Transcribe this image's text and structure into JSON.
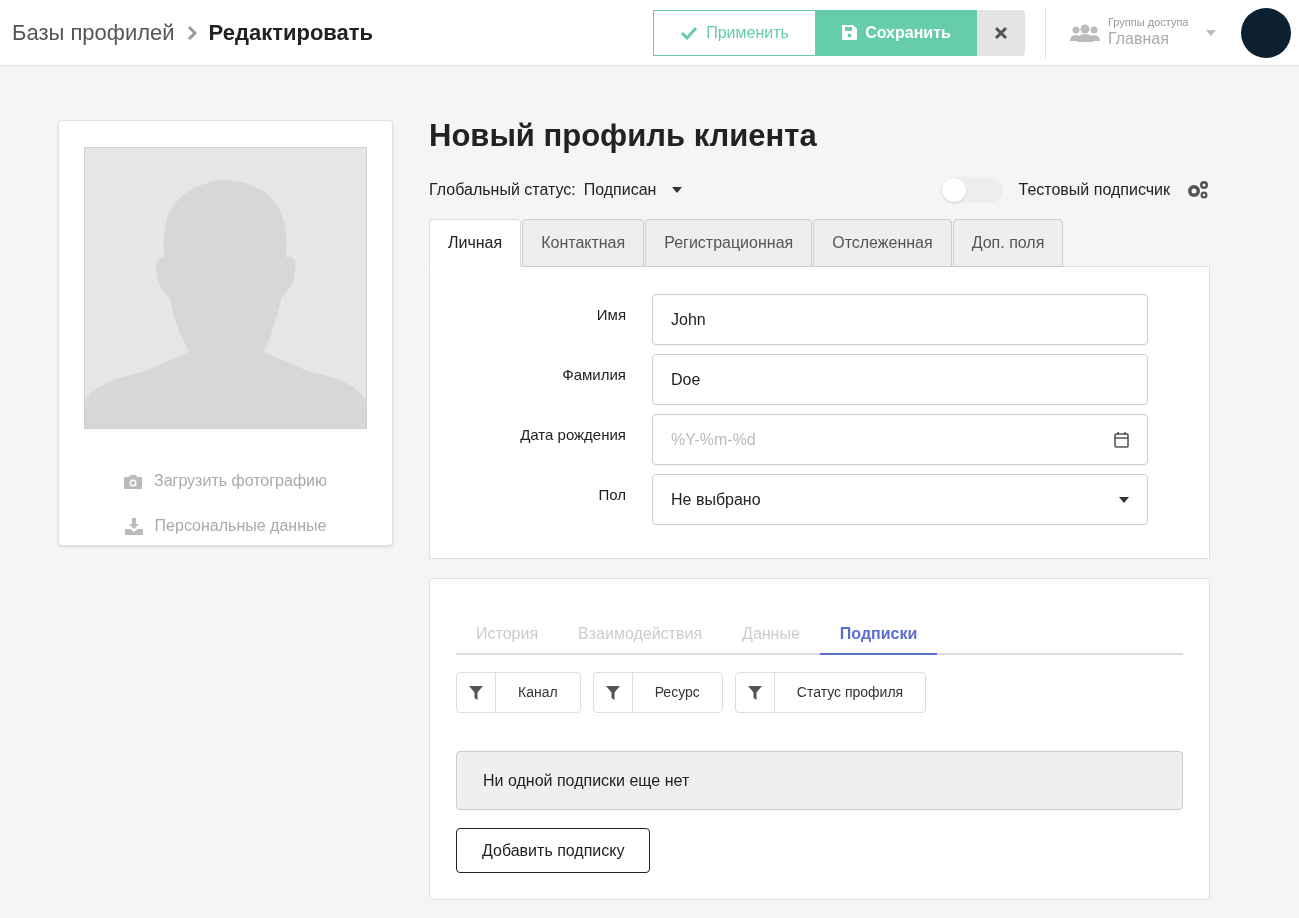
{
  "header": {
    "breadcrumb": [
      "Базы профилей",
      "Редактировать"
    ],
    "apply_button": "Применить",
    "save_button": "Сохранить",
    "access_group": {
      "label": "Группы доступа",
      "value": "Главная"
    }
  },
  "photo_card": {
    "actions": [
      "Загрузить фотографию",
      "Персональные данные"
    ]
  },
  "title": "Новый профиль клиента",
  "global_status": {
    "label": "Глобальный статус:",
    "value": "Подписан"
  },
  "test_subscriber": {
    "label": "Тестовый подписчик",
    "on": false
  },
  "tabs": [
    {
      "label": "Личная",
      "selected": true
    },
    {
      "label": "Контактная",
      "selected": false
    },
    {
      "label": "Регистрационная",
      "selected": false
    },
    {
      "label": "Отслеженная",
      "selected": false
    },
    {
      "label": "Доп. поля",
      "selected": false
    }
  ],
  "fields": [
    {
      "kind": "text",
      "label": "Имя",
      "value": "John"
    },
    {
      "kind": "text",
      "label": "Фамилия",
      "value": "Doe"
    },
    {
      "kind": "date",
      "label": "Дата рождения",
      "placeholder": "%Y-%m-%d"
    },
    {
      "kind": "select",
      "label": "Пол",
      "value": "Не выбрано"
    }
  ],
  "lower_tabs": [
    {
      "label": "История",
      "selected": false
    },
    {
      "label": "Взаимодействия",
      "selected": false
    },
    {
      "label": "Данные",
      "selected": false
    },
    {
      "label": "Подписки",
      "selected": true
    }
  ],
  "filters": [
    "Канал",
    "Ресурс",
    "Статус профиля"
  ],
  "empty_message": "Ни одной подписки еще нет",
  "add_button": "Добавить подписку"
}
